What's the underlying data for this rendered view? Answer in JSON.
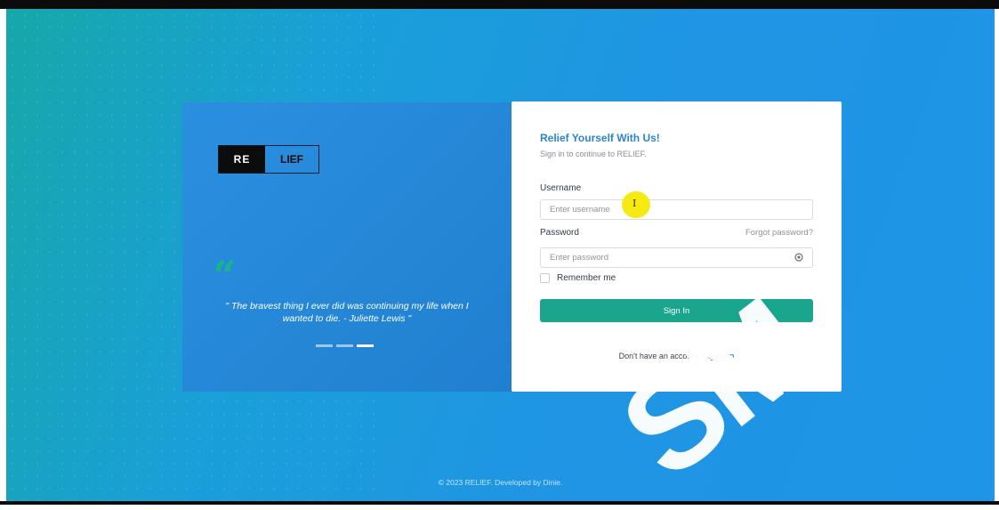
{
  "brand": {
    "logo_left": "RE",
    "logo_right": "LIEF"
  },
  "hero": {
    "quote_mark": "“",
    "quote": "\" The bravest thing I ever did was continuing my life when I wanted to die. - Juliette Lewis \"",
    "carousel": {
      "count": 3,
      "active_index": 2
    }
  },
  "login": {
    "title": "Relief Yourself With Us!",
    "subtitle": "Sign in to continue to RELIEF.",
    "username_label": "Username",
    "username_placeholder": "Enter username",
    "password_label": "Password",
    "forgot_password": "Forgot password?",
    "password_placeholder": "Enter password",
    "remember_me": "Remember me",
    "sign_in_button": "Sign In",
    "no_account_text": "Don't have an account ?",
    "signup_link": "Signup"
  },
  "footer": {
    "text": "© 2023 RELIEF. Developed by Dinie."
  },
  "watermark": "SM",
  "colors": {
    "accent_blue": "#2a86c7",
    "button_teal": "#1aa58f",
    "background_blue": "#1e95e6",
    "quote_green": "#19b48a"
  },
  "icons": {
    "password_toggle": "eye-icon",
    "cursor": "text-cursor-icon"
  }
}
